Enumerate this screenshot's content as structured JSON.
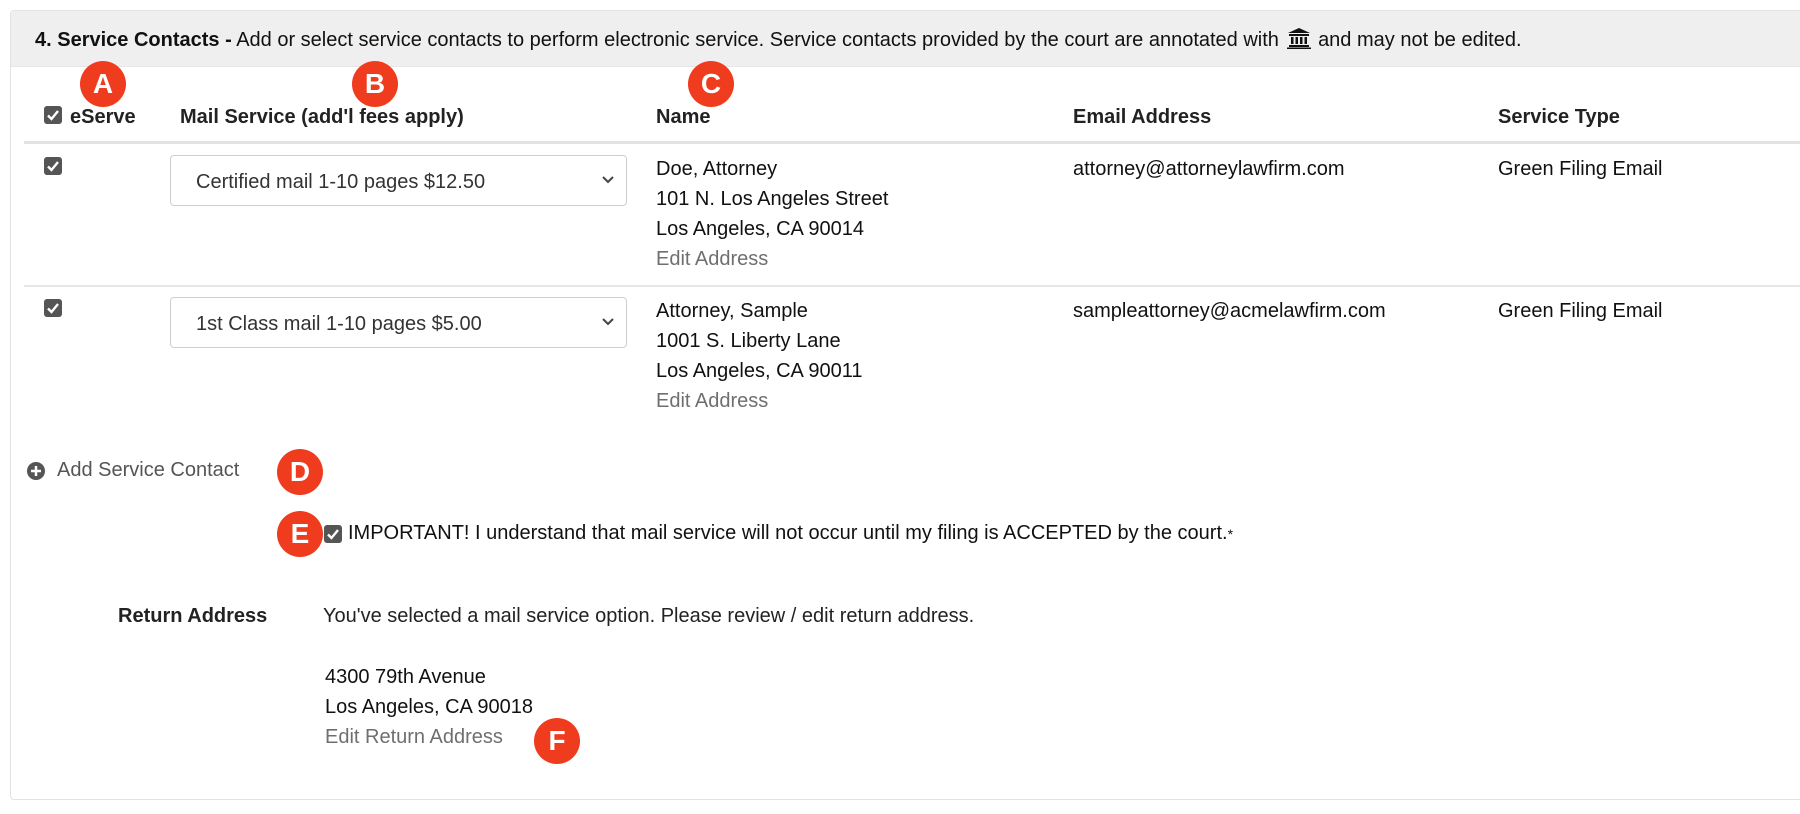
{
  "section": {
    "step_label": "4. Service Contacts -",
    "description_before_icon": "Add or select service contacts to perform electronic service. Service contacts provided by the court are annotated with",
    "description_icon": "court-building-icon",
    "description_after_icon": "and may not be edited."
  },
  "table": {
    "headers": {
      "eserve": "eServe",
      "mail_service": "Mail Service (add'l fees apply)",
      "name": "Name",
      "email": "Email Address",
      "service_type": "Service Type"
    },
    "eserve_all_checked": true,
    "rows": [
      {
        "eserve_checked": true,
        "mail_service": "Certified mail 1-10 pages $12.50",
        "name": "Doe, Attorney",
        "address_line1": "101 N. Los Angeles Street",
        "address_line2": "Los Angeles, CA 90014",
        "edit_link": "Edit Address",
        "email": "attorney@attorneylawfirm.com",
        "service_type": "Green Filing Email"
      },
      {
        "eserve_checked": true,
        "mail_service": "1st Class mail 1-10 pages $5.00",
        "name": "Attorney, Sample",
        "address_line1": "1001 S. Liberty Lane",
        "address_line2": "Los Angeles, CA 90011",
        "edit_link": "Edit Address",
        "email": "sampleattorney@acmelawfirm.com",
        "service_type": "Green Filing Email"
      }
    ]
  },
  "add_contact": {
    "icon": "plus-circle-icon",
    "label": "Add Service Contact"
  },
  "acknowledgement": {
    "checked": true,
    "text": "IMPORTANT! I understand that mail service will not occur until my filing is ACCEPTED by the court.",
    "required_mark": "*"
  },
  "return_address": {
    "label": "Return Address",
    "note": "You've selected a mail service option. Please review / edit return address.",
    "line1": "4300 79th Avenue",
    "line2": "Los Angeles, CA 90018",
    "edit_link": "Edit Return Address"
  },
  "markers": [
    "A",
    "B",
    "C",
    "D",
    "E",
    "F"
  ],
  "colors": {
    "marker": "#ef3b1e",
    "heading_bg": "#efefef",
    "checkbox": "#555555",
    "link": "#6f6f6f"
  }
}
